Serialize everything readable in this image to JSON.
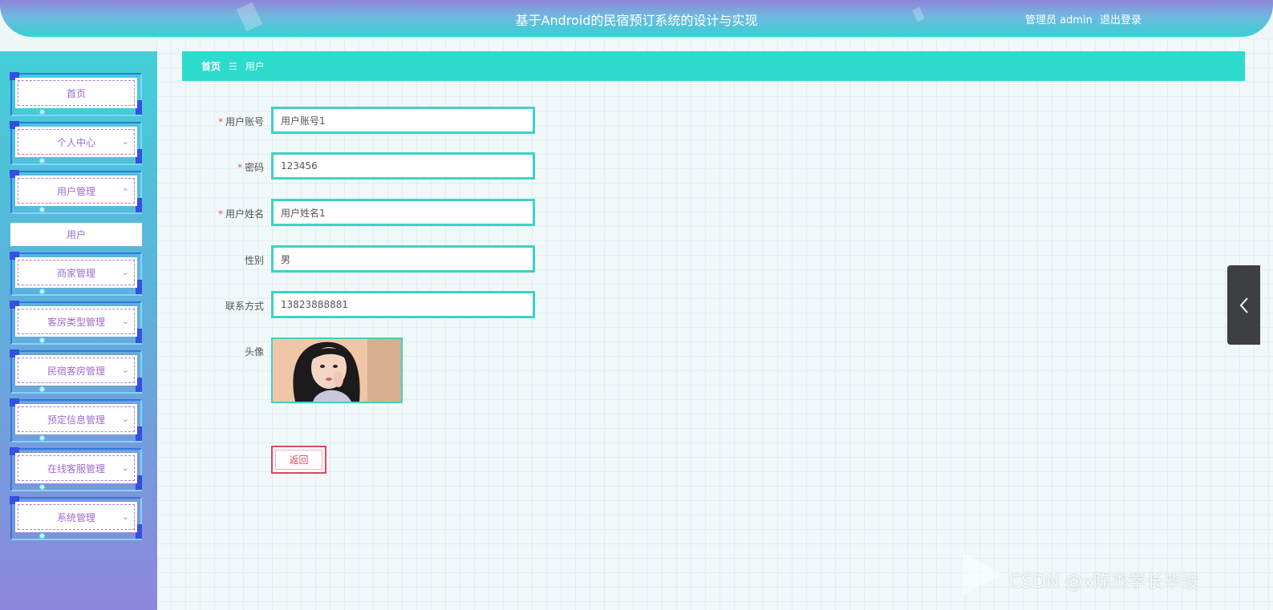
{
  "header": {
    "title": "基于Android的民宿预订系统的设计与实现",
    "admin_label": "管理员 admin",
    "logout_label": "退出登录"
  },
  "sidebar": {
    "items": [
      {
        "label": "首页",
        "has_chevron": false
      },
      {
        "label": "个人中心",
        "chevron": "chevron-down"
      },
      {
        "label": "用户管理",
        "chevron": "chevron-up"
      },
      {
        "label": "商家管理",
        "chevron": "chevron-down"
      },
      {
        "label": "客房类型管理",
        "chevron": "chevron-down"
      },
      {
        "label": "民宿客房管理",
        "chevron": "chevron-down"
      },
      {
        "label": "预定信息管理",
        "chevron": "chevron-down"
      },
      {
        "label": "在线客服管理",
        "chevron": "chevron-down"
      },
      {
        "label": "系统管理",
        "chevron": "chevron-down"
      }
    ],
    "sub_item": "用户"
  },
  "breadcrumb": {
    "home": "首页",
    "separator": "☰",
    "current": "用户"
  },
  "form": {
    "fields": [
      {
        "label": "用户账号",
        "required": true,
        "value": "用户账号1"
      },
      {
        "label": "密码",
        "required": true,
        "value": "123456"
      },
      {
        "label": "用户姓名",
        "required": true,
        "value": "用户姓名1"
      },
      {
        "label": "性别",
        "required": false,
        "value": "男"
      },
      {
        "label": "联系方式",
        "required": false,
        "value": "13823888881"
      }
    ],
    "avatar_label": "头像",
    "back_label": "返回"
  },
  "watermark": "CSDN @x陈杰学长毕设",
  "colors": {
    "accent": "#2ddbcc",
    "menu_text": "#a06bd0",
    "danger": "#d94a57"
  }
}
